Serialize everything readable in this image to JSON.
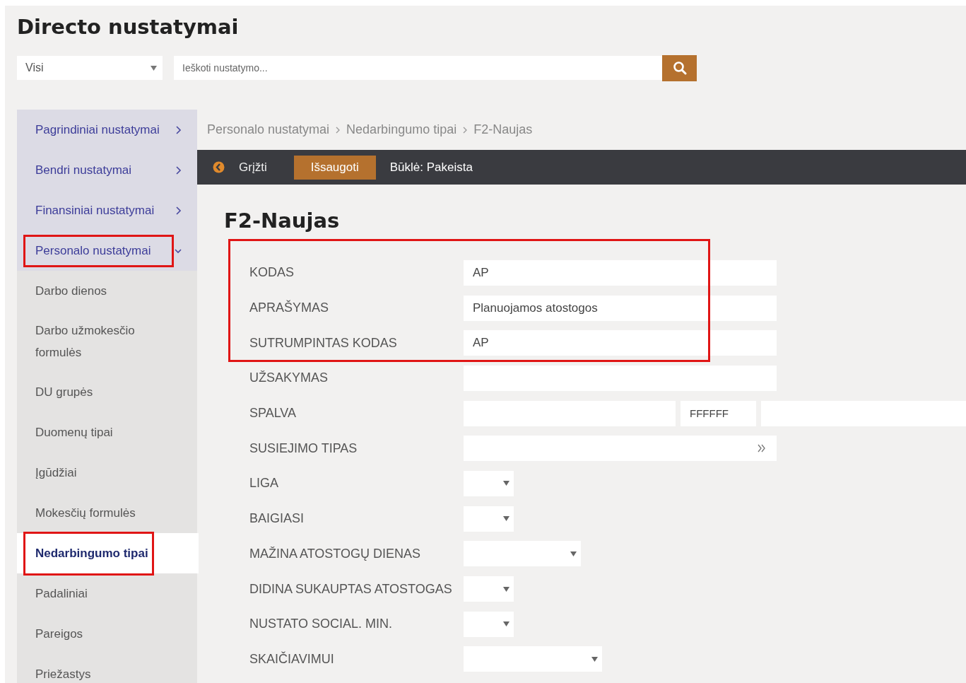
{
  "page_title": "Directo nustatymai",
  "filter": {
    "value": "Visi"
  },
  "search": {
    "placeholder": "Ieškoti nustatymo..."
  },
  "sidebar": {
    "items": [
      {
        "label": "Pagrindiniai nustatymai",
        "kind": "category",
        "expanded": false,
        "selected": false,
        "highlighted": false
      },
      {
        "label": "Bendri nustatymai",
        "kind": "category",
        "expanded": false,
        "selected": false,
        "highlighted": false
      },
      {
        "label": "Finansiniai nustatymai",
        "kind": "category",
        "expanded": false,
        "selected": false,
        "highlighted": false
      },
      {
        "label": "Personalo nustatymai",
        "kind": "category",
        "expanded": true,
        "selected": false,
        "highlighted": true
      },
      {
        "label": "Darbo dienos",
        "kind": "page",
        "selected": false,
        "highlighted": false
      },
      {
        "label": "Darbo užmokesčio formulės",
        "kind": "page",
        "selected": false,
        "highlighted": false
      },
      {
        "label": "DU grupės",
        "kind": "page",
        "selected": false,
        "highlighted": false
      },
      {
        "label": "Duomenų tipai",
        "kind": "page",
        "selected": false,
        "highlighted": false
      },
      {
        "label": "Įgūdžiai",
        "kind": "page",
        "selected": false,
        "highlighted": false
      },
      {
        "label": "Mokesčių formulės",
        "kind": "page",
        "selected": false,
        "highlighted": false
      },
      {
        "label": "Nedarbingumo tipai",
        "kind": "page",
        "selected": true,
        "highlighted": true
      },
      {
        "label": "Padaliniai",
        "kind": "page",
        "selected": false,
        "highlighted": false
      },
      {
        "label": "Pareigos",
        "kind": "page",
        "selected": false,
        "highlighted": false
      },
      {
        "label": "Priežastys",
        "kind": "page",
        "selected": false,
        "highlighted": false
      }
    ]
  },
  "breadcrumbs": [
    "Personalo nustatymai",
    "Nedarbingumo tipai",
    "F2-Naujas"
  ],
  "toolbar": {
    "back": "Grįžti",
    "save": "Išsaugoti",
    "status": "Būklė: Pakeista"
  },
  "form": {
    "title": "F2-Naujas",
    "rows": [
      {
        "label": "KODAS",
        "kind": "text",
        "value": "AP",
        "highlighted": true
      },
      {
        "label": "APRAŠYMAS",
        "kind": "text",
        "value": "Planuojamos atostogos",
        "highlighted": true
      },
      {
        "label": "SUTRUMPINTAS KODAS",
        "kind": "text",
        "value": "AP",
        "highlighted": true
      },
      {
        "label": "UŽSAKYMAS",
        "kind": "text",
        "value": "",
        "highlighted": false
      },
      {
        "label": "SPALVA",
        "kind": "color",
        "value": "FFFFFF",
        "highlighted": false
      },
      {
        "label": "SUSIEJIMO TIPAS",
        "kind": "link",
        "value": "",
        "highlighted": false
      },
      {
        "label": "LIGA",
        "kind": "yesno",
        "highlighted": false
      },
      {
        "label": "BAIGIASI",
        "kind": "yesno",
        "highlighted": false
      },
      {
        "label": "MAŽINA ATOSTOGŲ DIENAS",
        "kind": "select",
        "highlighted": false
      },
      {
        "label": "DIDINA SUKAUPTAS ATOSTOGAS",
        "kind": "yesno",
        "highlighted": false
      },
      {
        "label": "NUSTATO SOCIAL. MIN.",
        "kind": "yesno",
        "highlighted": false
      },
      {
        "label": "SKAIČIAVIMUI",
        "kind": "listselect",
        "highlighted": false
      }
    ]
  }
}
